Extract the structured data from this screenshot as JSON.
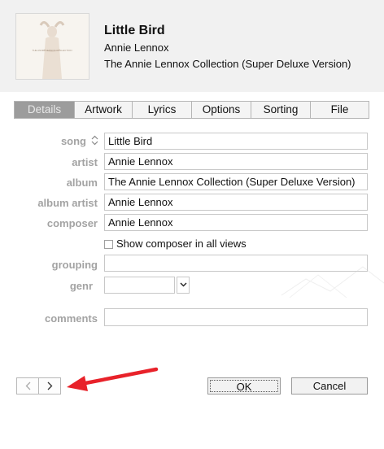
{
  "track": {
    "title": "Little Bird",
    "artist": "Annie Lennox",
    "album": "The Annie Lennox Collection (Super Deluxe Version)",
    "artwork_text": "THE ANNIE LENNOX COLLECTION"
  },
  "tabs": [
    {
      "label": "Details",
      "active": true
    },
    {
      "label": "Artwork",
      "active": false
    },
    {
      "label": "Lyrics",
      "active": false
    },
    {
      "label": "Options",
      "active": false
    },
    {
      "label": "Sorting",
      "active": false
    },
    {
      "label": "File",
      "active": false
    }
  ],
  "fields": {
    "song": {
      "label": "song",
      "value": "Little Bird"
    },
    "artist": {
      "label": "artist",
      "value": "Annie Lennox"
    },
    "album": {
      "label": "album",
      "value": "The Annie Lennox Collection (Super Deluxe Version)"
    },
    "album_artist": {
      "label": "album artist",
      "value": "Annie Lennox"
    },
    "composer": {
      "label": "composer",
      "value": "Annie Lennox"
    },
    "show_composer": {
      "label": "Show composer in all views",
      "checked": false
    },
    "grouping": {
      "label": "grouping",
      "value": ""
    },
    "genre": {
      "label": "genr",
      "value": ""
    },
    "comments": {
      "label": "comments",
      "value": ""
    }
  },
  "buttons": {
    "ok": "OK",
    "cancel": "Cancel"
  },
  "icons": {
    "sort": "sort-updown-icon",
    "prev": "chevron-left-icon",
    "next": "chevron-right-icon",
    "genre_dropdown": "chevron-down-icon"
  },
  "colors": {
    "annotation_arrow": "#e8222a",
    "active_tab": "#9c9c9c",
    "label_gray": "#a3a3a3"
  }
}
